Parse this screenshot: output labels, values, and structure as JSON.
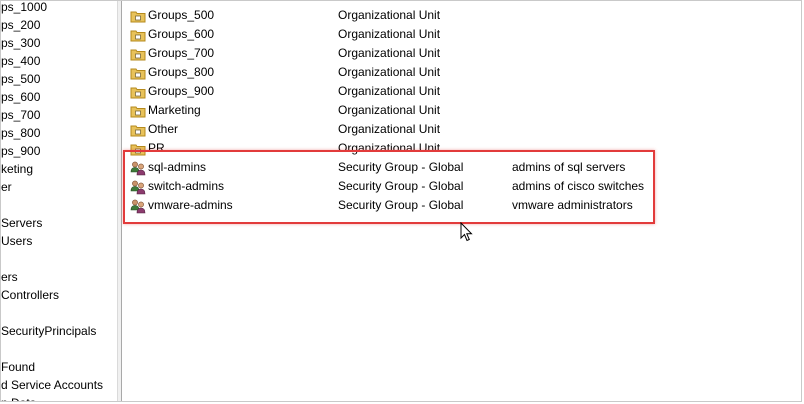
{
  "tree": {
    "items": [
      "ps_1000",
      "ps_200",
      "ps_300",
      "ps_400",
      "ps_500",
      "ps_600",
      "ps_700",
      "ps_800",
      "ps_900",
      "keting",
      "er",
      "",
      "Servers",
      "Users",
      "",
      "ers",
      " Controllers",
      "",
      "SecurityPrincipals",
      "",
      "Found",
      "d Service Accounts",
      "n Data"
    ]
  },
  "list": {
    "rows": [
      {
        "name": "Groups_500",
        "type": "Organizational Unit",
        "description": "",
        "icon": "ou-folder-icon"
      },
      {
        "name": "Groups_600",
        "type": "Organizational Unit",
        "description": "",
        "icon": "ou-folder-icon"
      },
      {
        "name": "Groups_700",
        "type": "Organizational Unit",
        "description": "",
        "icon": "ou-folder-icon"
      },
      {
        "name": "Groups_800",
        "type": "Organizational Unit",
        "description": "",
        "icon": "ou-folder-icon"
      },
      {
        "name": "Groups_900",
        "type": "Organizational Unit",
        "description": "",
        "icon": "ou-folder-icon"
      },
      {
        "name": "Marketing",
        "type": "Organizational Unit",
        "description": "",
        "icon": "ou-folder-icon"
      },
      {
        "name": "Other",
        "type": "Organizational Unit",
        "description": "",
        "icon": "ou-folder-icon"
      },
      {
        "name": "PR",
        "type": "Organizational Unit",
        "description": "",
        "icon": "ou-folder-icon"
      },
      {
        "name": "sql-admins",
        "type": "Security Group - Global",
        "description": "admins of sql servers",
        "icon": "security-group-icon"
      },
      {
        "name": "switch-admins",
        "type": "Security Group - Global",
        "description": "admins of cisco switches",
        "icon": "security-group-icon"
      },
      {
        "name": "vmware-admins",
        "type": "Security Group - Global",
        "description": "vmware administrators",
        "icon": "security-group-icon"
      }
    ]
  },
  "colors": {
    "highlight": "#e23b3b",
    "folder_fill": "#e8c25a",
    "folder_edge": "#b58a1c"
  }
}
